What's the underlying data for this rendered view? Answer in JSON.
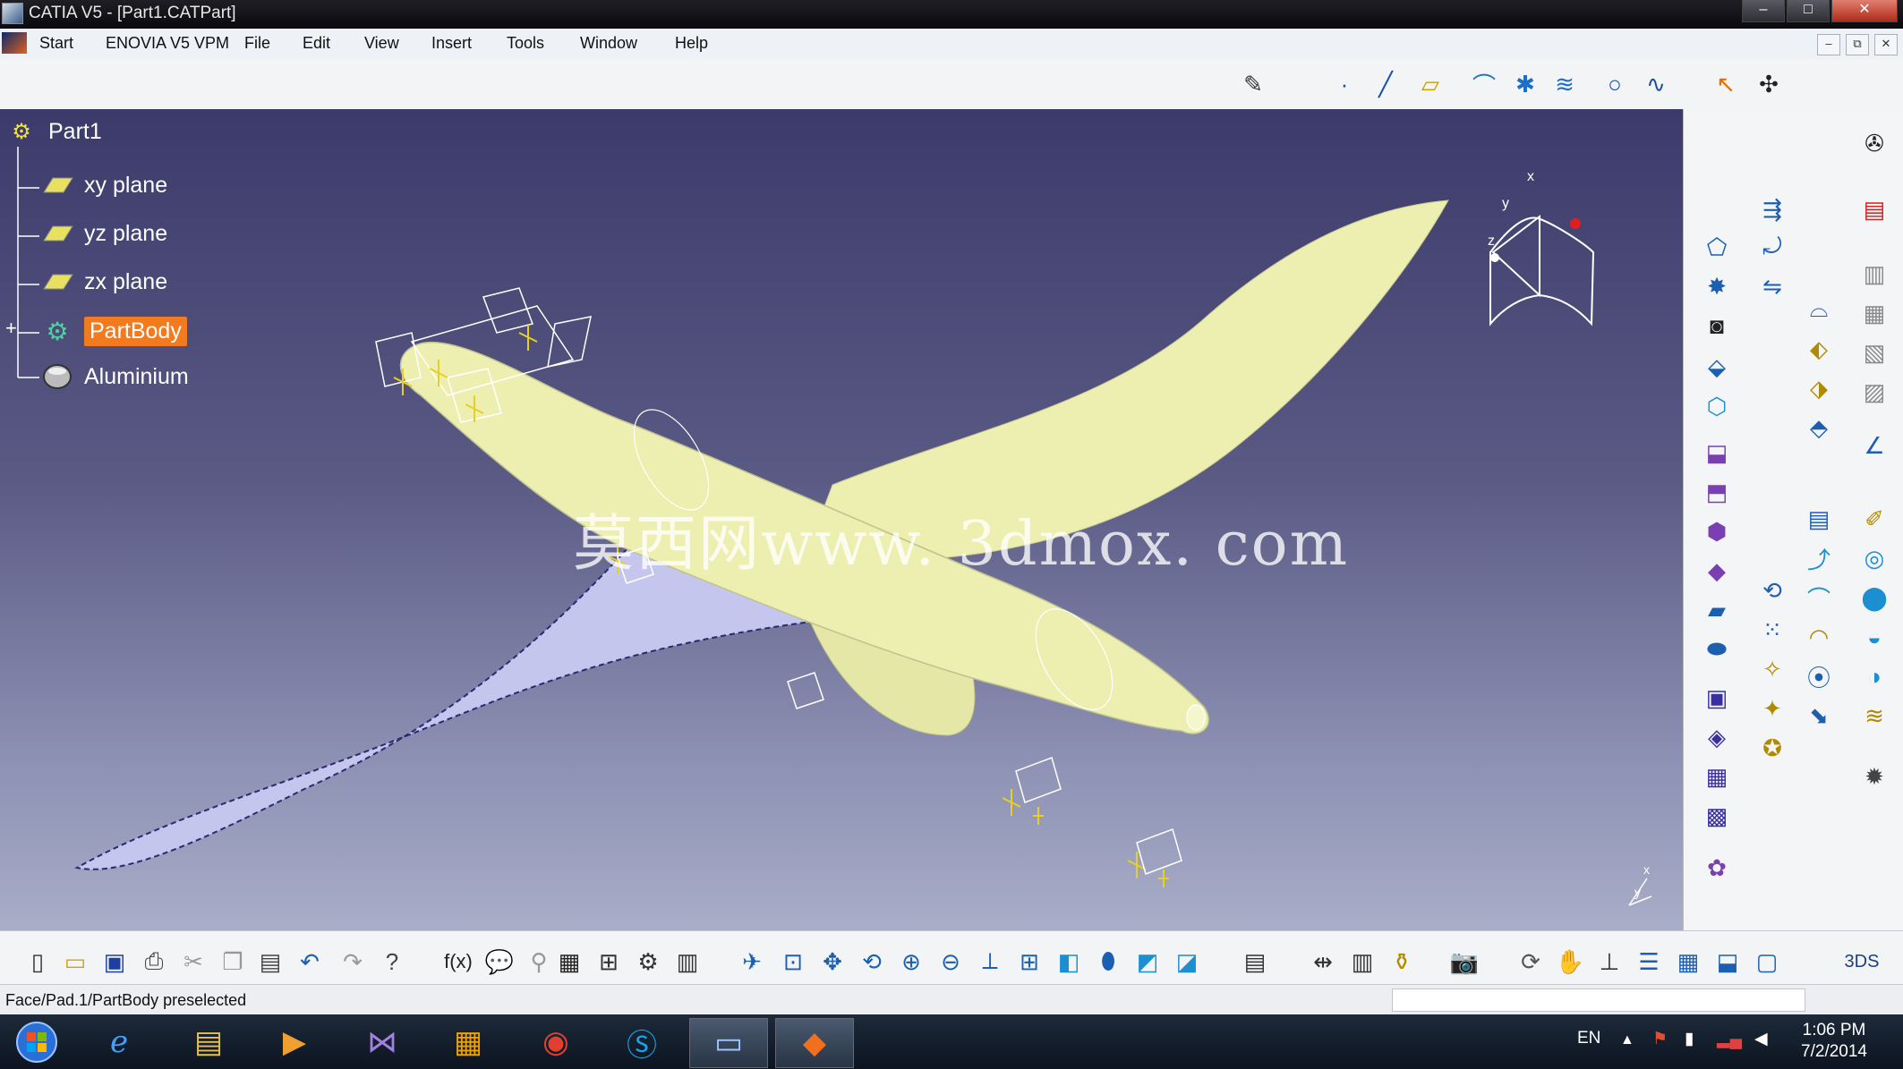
{
  "window": {
    "title": "CATIA V5 - [Part1.CATPart]",
    "min": "–",
    "max": "□",
    "close": "✕"
  },
  "menu": {
    "items": [
      "Start",
      "ENOVIA V5 VPM",
      "File",
      "Edit",
      "View",
      "Insert",
      "Tools",
      "Window",
      "Help"
    ]
  },
  "mdi": {
    "min": "–",
    "restore": "⧉",
    "close": "✕"
  },
  "tree": {
    "root": "Part1",
    "items": [
      {
        "label": "xy plane",
        "icon": "plane-icon"
      },
      {
        "label": "yz plane",
        "icon": "plane-icon"
      },
      {
        "label": "zx plane",
        "icon": "plane-icon"
      },
      {
        "label": "PartBody",
        "icon": "body-icon",
        "highlighted": true
      },
      {
        "label": "Aluminium",
        "icon": "material-icon"
      }
    ]
  },
  "compass": {
    "x": "x",
    "y": "y",
    "z": "z"
  },
  "axis_indicator": {
    "x": "x",
    "y": "y"
  },
  "watermark": "莫西网www. 3dmox. com",
  "status": {
    "message": "Face/Pad.1/PartBody preselected"
  },
  "taskbar": {
    "language": "EN",
    "time": "1:06 PM",
    "date": "7/2/2014"
  },
  "colors": {
    "highlight": "#f47a1e",
    "part": "#ecefb0",
    "wing_shade": "#c5c6ee"
  }
}
